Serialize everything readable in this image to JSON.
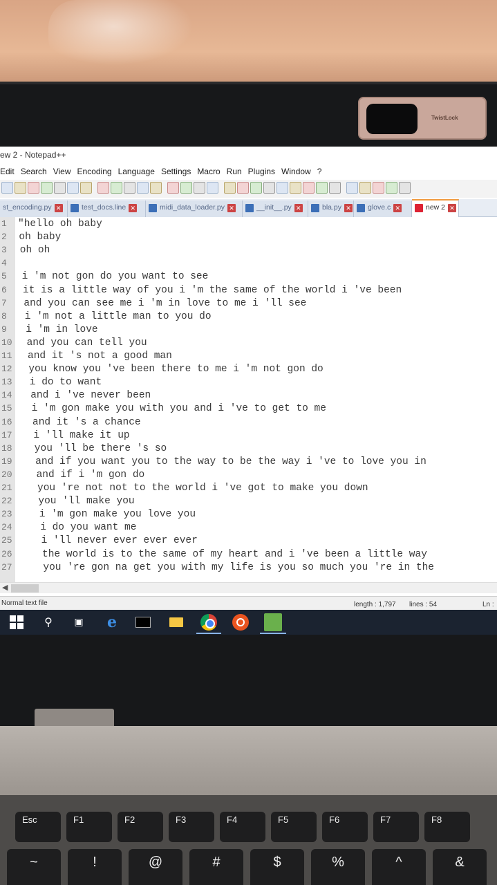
{
  "window": {
    "title": "ew 2 - Notepad++"
  },
  "menu": [
    "Edit",
    "Search",
    "View",
    "Encoding",
    "Language",
    "Settings",
    "Macro",
    "Run",
    "Plugins",
    "Window",
    "?"
  ],
  "toolbar_icons": [
    "new-file-icon",
    "open-file-icon",
    "save-icon",
    "save-all-icon",
    "close-icon",
    "close-all-icon",
    "print-icon",
    "cut-icon",
    "copy-icon",
    "paste-icon",
    "undo-icon",
    "redo-icon",
    "find-icon",
    "replace-icon",
    "zoom-in-icon",
    "zoom-out-icon",
    "sync-vertical-icon",
    "sync-horizontal-icon",
    "word-wrap-icon",
    "show-all-chars-icon",
    "indent-guide-icon",
    "document-map-icon",
    "function-list-icon",
    "folder-workspace-icon",
    "monitoring-icon",
    "record-macro-icon",
    "stop-macro-icon",
    "play-macro-icon",
    "run-macro-multiple-icon",
    "save-macro-icon"
  ],
  "tabs": [
    {
      "label": "st_encoding.py",
      "active": false
    },
    {
      "label": "test_docs.line",
      "active": false
    },
    {
      "label": "midi_data_loader.py",
      "active": false
    },
    {
      "label": "__init__.py",
      "active": false
    },
    {
      "label": "bla.py",
      "active": false
    },
    {
      "label": "glove.c",
      "active": false
    },
    {
      "label": "new 2",
      "active": true
    }
  ],
  "editor": {
    "lines": [
      {
        "num": "1",
        "text": "\"hello oh baby"
      },
      {
        "num": "2",
        "text": "oh baby"
      },
      {
        "num": "3",
        "text": "oh oh"
      },
      {
        "num": "4",
        "text": ""
      },
      {
        "num": "5",
        "text": "i 'm not gon do you want to see"
      },
      {
        "num": "6",
        "text": "it is a little way of you i 'm the same of the world i 've been"
      },
      {
        "num": "7",
        "text": "and you can see me i 'm in love to me i 'll see"
      },
      {
        "num": "8",
        "text": "i 'm not a little man to you do"
      },
      {
        "num": "9",
        "text": "i 'm in love"
      },
      {
        "num": "10",
        "text": "and you can tell you"
      },
      {
        "num": "11",
        "text": "and it 's not a good man"
      },
      {
        "num": "12",
        "text": "you know you 've been there to me i 'm not gon do"
      },
      {
        "num": "13",
        "text": "i do to want"
      },
      {
        "num": "14",
        "text": "and i 've never been"
      },
      {
        "num": "15",
        "text": "i 'm gon make you with you and i 've to get to me"
      },
      {
        "num": "16",
        "text": "and it 's a chance"
      },
      {
        "num": "17",
        "text": "i 'll make it up"
      },
      {
        "num": "18",
        "text": "you 'll be there 's so"
      },
      {
        "num": "19",
        "text": "and if you want you to the way to be the way i 've to love you in"
      },
      {
        "num": "20",
        "text": "and if i 'm gon do"
      },
      {
        "num": "21",
        "text": "you 're not not to the world i 've got to make you down"
      },
      {
        "num": "22",
        "text": "you 'll make you"
      },
      {
        "num": "23",
        "text": "i 'm gon make you love you"
      },
      {
        "num": "24",
        "text": "i do you want me"
      },
      {
        "num": "25",
        "text": "i 'll never ever ever ever"
      },
      {
        "num": "26",
        "text": "the world is to the same of my heart and i 've been a little way"
      },
      {
        "num": "27",
        "text": "you 're gon na get you with my life is you so much you 're in the"
      }
    ]
  },
  "statusbar": {
    "file_type": "Normal text file",
    "length": "length : 1,797",
    "lines": "lines : 54",
    "ln": "Ln :"
  },
  "taskbar_icons": [
    "windows-start-icon",
    "search-icon",
    "task-view-icon",
    "edge-icon",
    "terminal-icon",
    "file-explorer-icon",
    "chrome-icon",
    "ubuntu-icon",
    "notepadpp-icon"
  ],
  "webcam_cover_label": "TwistLock",
  "keyboard": {
    "fn_row": [
      "Esc",
      "F1",
      "F2",
      "F3",
      "F4",
      "F5",
      "F6",
      "F7",
      "F8"
    ],
    "num_row": [
      "~",
      "!",
      "@",
      "#",
      "$",
      "%",
      "^",
      "&"
    ]
  },
  "colors": {
    "active_tab_accent": "#f09a3e",
    "taskbar": "#1b2330",
    "gutter": "#e4e4e4"
  }
}
